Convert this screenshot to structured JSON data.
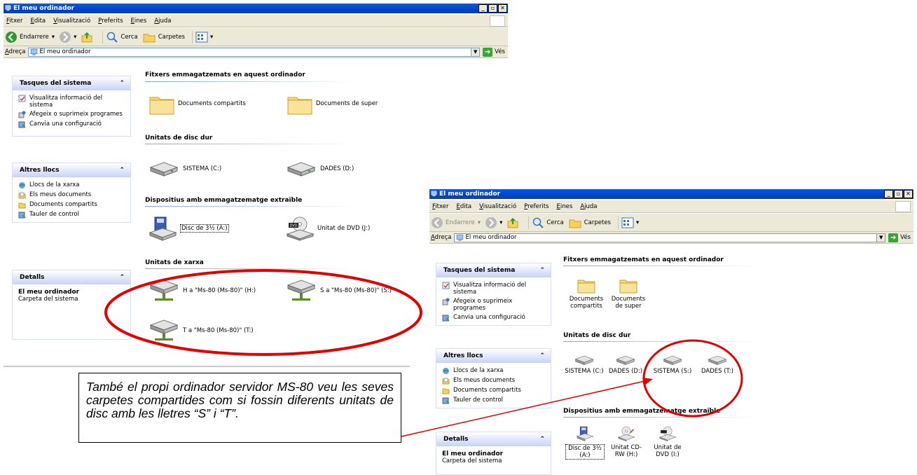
{
  "window1": {
    "title": "El meu ordinador",
    "menu": [
      "Fitxer",
      "Edita",
      "Visualització",
      "Preferits",
      "Eines",
      "Ajuda"
    ],
    "toolbar": {
      "back": "Endarrere",
      "search": "Cerca",
      "folders": "Carpetes"
    },
    "address": {
      "label": "Adreça",
      "value": "El meu ordinador",
      "go": "Vés"
    },
    "panels": {
      "system": {
        "title": "Tasques del sistema",
        "items": [
          "Visualitza informació del sistema",
          "Afegeix o suprimeix programes",
          "Canvia una configuració"
        ]
      },
      "places": {
        "title": "Altres llocs",
        "items": [
          "Llocs de la xarxa",
          "Els meus documents",
          "Documents compartits",
          "Tauler de control"
        ]
      },
      "details": {
        "title": "Detalls",
        "name": "El meu ordinador",
        "sub": "Carpeta del sistema"
      }
    },
    "sections": {
      "stored": {
        "title": "Fitxers emmagatzemats en aquest ordinador",
        "items": [
          "Documents compartits",
          "Documents de super"
        ]
      },
      "hdd": {
        "title": "Unitats de disc dur",
        "items": [
          "SISTEMA (C:)",
          "DADES (D:)"
        ]
      },
      "removable": {
        "title": "Dispositius amb emmagatzematge extraïble",
        "items": [
          "Disc de 3½ (A:)",
          "Unitat de DVD (J:)"
        ]
      },
      "network": {
        "title": "Unitats de xarxa",
        "items": [
          "H a \"Ms-80 (Ms-80)\" (H:)",
          "S a \"Ms-80 (Ms-80)\" (S:)",
          "T a \"Ms-80 (Ms-80)\" (T:)"
        ]
      }
    }
  },
  "window2": {
    "title": "El meu ordinador",
    "menu": [
      "Fitxer",
      "Edita",
      "Visualització",
      "Preferits",
      "Eines",
      "Ajuda"
    ],
    "toolbar": {
      "back": "Endarrere",
      "search": "Cerca",
      "folders": "Carpetes"
    },
    "address": {
      "label": "Adreça",
      "value": "El meu ordinador",
      "go": "Vés"
    },
    "panels": {
      "system": {
        "title": "Tasques del sistema",
        "items": [
          "Visualitza informació del sistema",
          "Afegeix o suprimeix programes",
          "Canvia una configuració"
        ]
      },
      "places": {
        "title": "Altres llocs",
        "items": [
          "Llocs de la xarxa",
          "Els meus documents",
          "Documents compartits",
          "Tauler de control"
        ]
      },
      "details": {
        "title": "Detalls",
        "name": "El meu ordinador",
        "sub": "Carpeta del sistema"
      }
    },
    "sections": {
      "stored": {
        "title": "Fitxers emmagatzemats en aquest ordinador",
        "items": [
          "Documents compartits",
          "Documents de super"
        ]
      },
      "hdd": {
        "title": "Unitats de disc dur",
        "items": [
          "SISTEMA (C:)",
          "DADES (D:)",
          "SISTEMA (S:)",
          "DADES (T:)"
        ]
      },
      "removable": {
        "title": "Dispositius amb emmagatzematge extraïble",
        "items": [
          "Disc de 3½ (A:)",
          "Unitat CD-RW (H:)",
          "Unitat de DVD (I:)"
        ]
      }
    }
  },
  "annotation": {
    "text": "També el propi ordinador servidor MS-80 veu les seves carpetes compartides com si fossin diferents unitats de disc amb les lletres “S” i “T”.",
    "color": "#e00000"
  }
}
